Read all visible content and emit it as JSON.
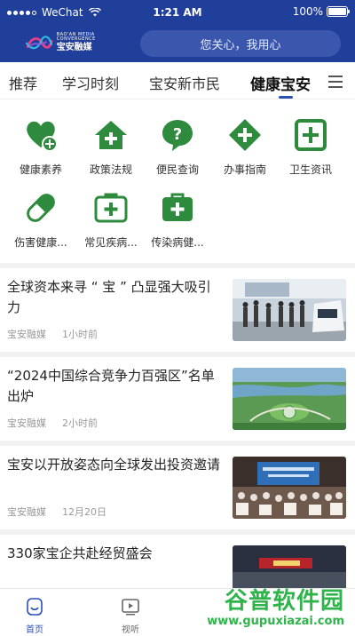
{
  "status_bar": {
    "carrier": "WeChat",
    "time": "1:21 AM",
    "battery": "100%"
  },
  "header": {
    "logo_en": "BAO'AN MEDIA CONVERGENCE",
    "logo_cn": "宝安融媒",
    "search_placeholder": "您关心，我用心"
  },
  "tabs": [
    {
      "label": "推荐",
      "active": false
    },
    {
      "label": "学习时刻",
      "active": false
    },
    {
      "label": "宝安新市民",
      "active": false
    },
    {
      "label": "健康宝安",
      "active": true
    }
  ],
  "categories": [
    {
      "label": "健康素养",
      "icon": "heart-plus-icon"
    },
    {
      "label": "政策法规",
      "icon": "house-plus-icon"
    },
    {
      "label": "便民查询",
      "icon": "question-bubble-icon"
    },
    {
      "label": "办事指南",
      "icon": "diamond-plus-icon"
    },
    {
      "label": "卫生资讯",
      "icon": "square-plus-icon"
    },
    {
      "label": "伤害健康...",
      "icon": "pill-icon"
    },
    {
      "label": "常见疾病...",
      "icon": "medkit-icon"
    },
    {
      "label": "传染病健...",
      "icon": "medkit-icon"
    }
  ],
  "news": [
    {
      "title": "全球资本来寻 “ 宝 ” 凸显强大吸引力",
      "source": "宝安融媒",
      "time": "1小时前"
    },
    {
      "title": "“2024中国综合竞争力百强区”名单出炉",
      "source": "宝安融媒",
      "time": "2小时前"
    },
    {
      "title": "宝安以开放姿态向全球发出投资邀请",
      "source": "宝安融媒",
      "time": "12月20日"
    },
    {
      "title": "330家宝企共赴经贸盛会",
      "source": "",
      "time": ""
    }
  ],
  "bottom_nav": [
    {
      "label": "首页",
      "active": true
    },
    {
      "label": "视听",
      "active": false
    }
  ],
  "watermark": {
    "cn": "谷普软件园",
    "url": "www.gupuxiazai.com"
  },
  "colors": {
    "header_bg": "#1f3f9a",
    "accent": "#2a4fb5",
    "icon_green": "#2e8b3d",
    "watermark": "#2fb34a"
  }
}
